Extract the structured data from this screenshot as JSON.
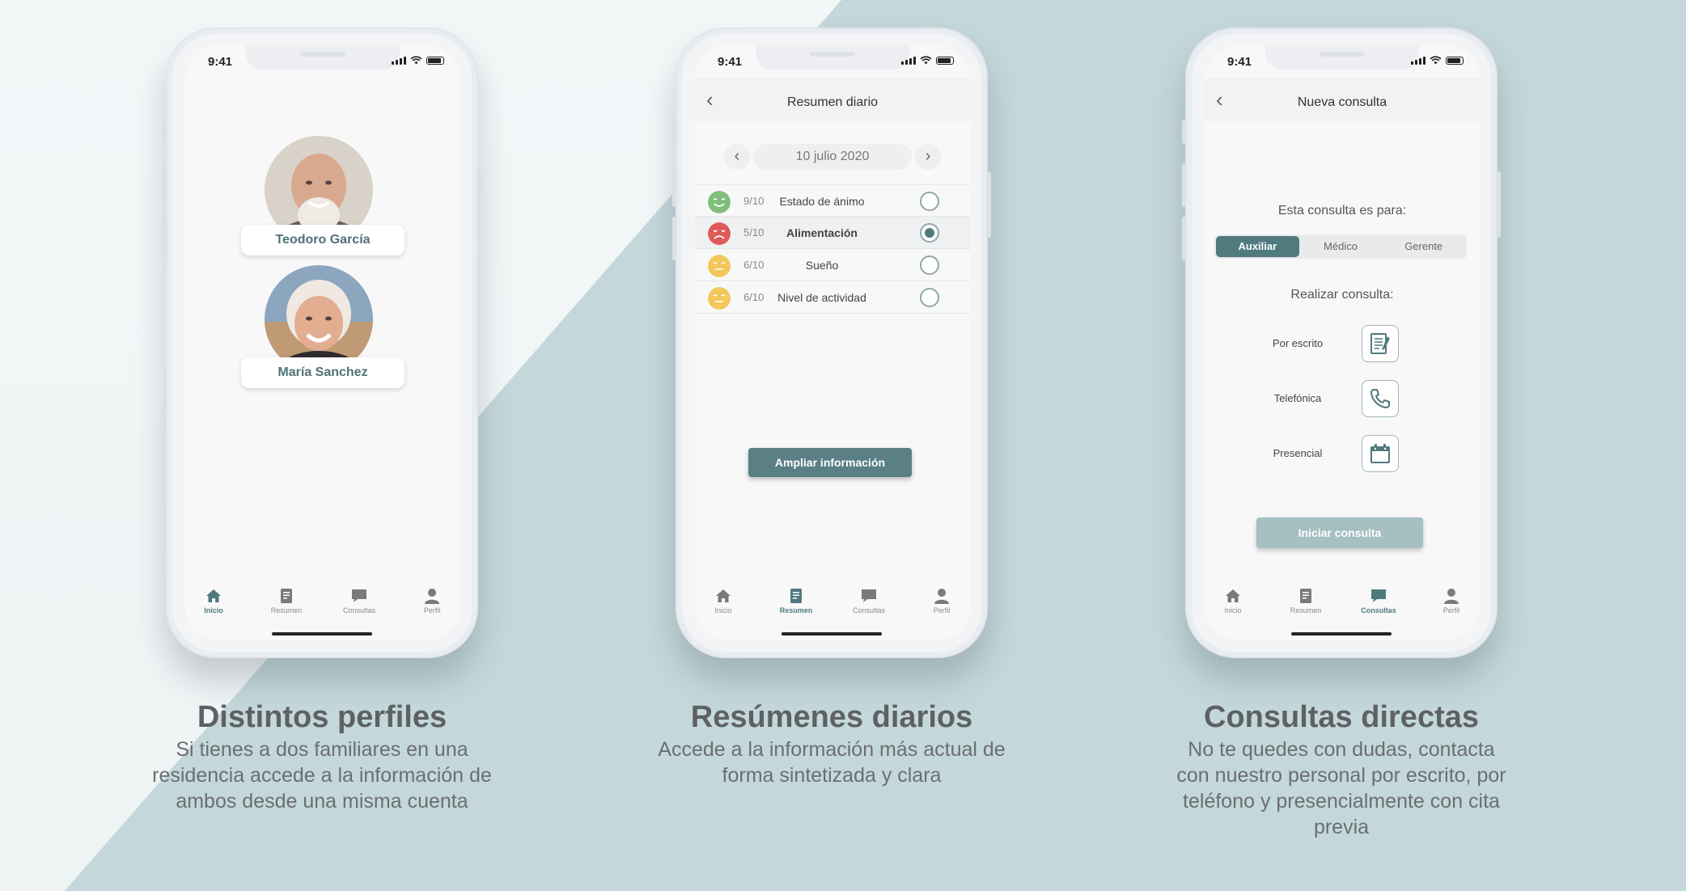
{
  "colors": {
    "accent": "#4f7a7e",
    "button": "#5a8085",
    "button_disabled": "#a5bfc2",
    "bg_teal": "#c4d8db"
  },
  "status_bar": {
    "time": "9:41"
  },
  "tabbar": [
    {
      "label": "Inicio",
      "icon": "home-icon"
    },
    {
      "label": "Resumen",
      "icon": "document-icon"
    },
    {
      "label": "Consultas",
      "icon": "chat-icon"
    },
    {
      "label": "Perfil",
      "icon": "user-icon"
    }
  ],
  "screen1": {
    "profiles": [
      {
        "name": "Teodoro García"
      },
      {
        "name": "María Sanchez"
      }
    ]
  },
  "screen2": {
    "title": "Resumen diario",
    "date": "10 julio 2020",
    "rows": [
      {
        "score": "9/10",
        "metric": "Estado de ánimo",
        "mood": "happy",
        "color": "#7fbf7a",
        "selected": false
      },
      {
        "score": "5/10",
        "metric": "Alimentación",
        "mood": "sad",
        "color": "#e05a57",
        "selected": true
      },
      {
        "score": "6/10",
        "metric": "Sueño",
        "mood": "neutral",
        "color": "#f2c85a",
        "selected": false
      },
      {
        "score": "6/10",
        "metric": "Nivel de actividad",
        "mood": "neutral",
        "color": "#f2c85a",
        "selected": false
      }
    ],
    "button": "Ampliar información"
  },
  "screen3": {
    "title": "Nueva consulta",
    "question": "Esta consulta es para:",
    "segments": [
      "Auxiliar",
      "Médico",
      "Gerente"
    ],
    "active_segment": "Auxiliar",
    "question2": "Realizar consulta:",
    "options": [
      {
        "label": "Por escrito",
        "icon": "written-note-icon"
      },
      {
        "label": "Telefónica",
        "icon": "phone-icon"
      },
      {
        "label": "Presencial",
        "icon": "calendar-icon"
      }
    ],
    "button": "Iniciar consulta"
  },
  "captions": [
    {
      "title": "Distintos perfiles",
      "lines": [
        "Si tienes a dos familiares en una",
        "residencia accede a la información de",
        "ambos desde una misma cuenta"
      ]
    },
    {
      "title": "Resúmenes diarios",
      "lines": [
        "Accede a la información más actual de",
        "forma sintetizada y clara"
      ]
    },
    {
      "title": "Consultas directas",
      "lines": [
        "No te quedes con dudas, contacta",
        "con nuestro personal por escrito, por",
        "teléfono y presencialmente con cita",
        "previa"
      ]
    }
  ]
}
